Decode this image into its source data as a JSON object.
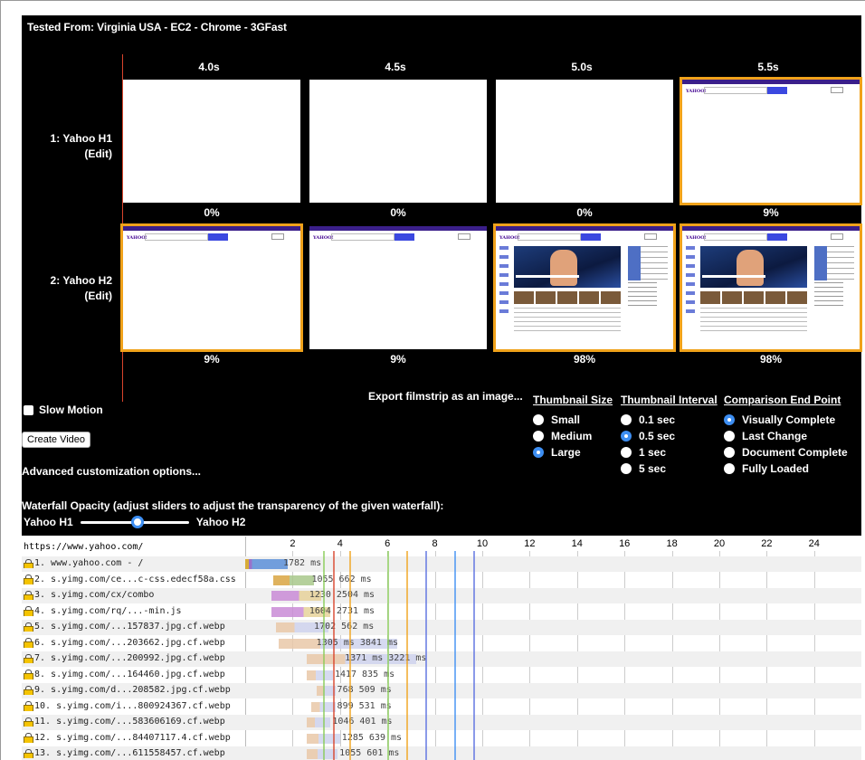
{
  "header": {
    "tested_from_prefix": "Tested From: Virginia USA - EC2 - ",
    "browser": "Chrome",
    "separator": " - ",
    "connection": "3GFast"
  },
  "filmstrip": {
    "times": [
      "4.0s",
      "4.5s",
      "5.0s",
      "5.5s"
    ],
    "rows": [
      {
        "label": "1: Yahoo H1",
        "edit": "(Edit)",
        "frames": [
          {
            "percent": "0%",
            "state": "blank"
          },
          {
            "percent": "0%",
            "state": "blank"
          },
          {
            "percent": "0%",
            "state": "blank"
          },
          {
            "percent": "9%",
            "state": "header",
            "changed": true
          }
        ]
      },
      {
        "label": "2: Yahoo H2",
        "edit": "(Edit)",
        "frames": [
          {
            "percent": "9%",
            "state": "header",
            "changed": true
          },
          {
            "percent": "9%",
            "state": "header"
          },
          {
            "percent": "98%",
            "state": "full",
            "changed": true
          },
          {
            "percent": "98%",
            "state": "full",
            "changed": true
          }
        ]
      }
    ],
    "thumb_logo": "YAHOO!"
  },
  "controls": {
    "export_label": "Export filmstrip as an image...",
    "slow_motion_label": "Slow Motion",
    "create_video_label": "Create Video",
    "advanced_label": "Advanced customization options...",
    "thumbnail_size": {
      "title": "Thumbnail Size",
      "options": [
        {
          "label": "Small",
          "selected": false
        },
        {
          "label": "Medium",
          "selected": false
        },
        {
          "label": "Large",
          "selected": true
        }
      ]
    },
    "thumbnail_interval": {
      "title": "Thumbnail Interval",
      "options": [
        {
          "label": "0.1 sec",
          "selected": false
        },
        {
          "label": "0.5 sec",
          "selected": true
        },
        {
          "label": "1 sec",
          "selected": false
        },
        {
          "label": "5 sec",
          "selected": false
        }
      ]
    },
    "comparison_end": {
      "title": "Comparison End Point",
      "options": [
        {
          "label": "Visually Complete",
          "selected": true
        },
        {
          "label": "Last Change",
          "selected": false
        },
        {
          "label": "Document Complete",
          "selected": false
        },
        {
          "label": "Fully Loaded",
          "selected": false
        }
      ]
    },
    "opacity_label": "Waterfall Opacity (adjust sliders to adjust the transparency of the given waterfall):",
    "slider_left": "Yahoo H1",
    "slider_right": "Yahoo H2",
    "slider_value": 0.5
  },
  "waterfall": {
    "url": "https://www.yahoo.com/",
    "ticks": [
      "2",
      "4",
      "6",
      "8",
      "10",
      "12",
      "14",
      "16",
      "18",
      "20",
      "22",
      "24"
    ],
    "colors": {
      "accent_blue": "#3d8ef2",
      "frame_orange": "#f0a21a",
      "red_line": "#d9442c"
    },
    "rows": [
      {
        "name": "1. www.yahoo.com - /",
        "timing": "1782 ms",
        "start": 0.0,
        "end": 1.78,
        "kind": "html"
      },
      {
        "name": "2. s.yimg.com/ce...c-css.edecf58a.css",
        "timing": "1055 662 ms",
        "start": 1.2,
        "end": 2.9,
        "kind": "css"
      },
      {
        "name": "3. s.yimg.com/cx/combo",
        "timing": "1230 2504 ms",
        "start": 1.1,
        "end": 3.2,
        "kind": "script"
      },
      {
        "name": "4. s.yimg.com/rq/...-min.js",
        "timing": "1604 2731 ms",
        "start": 1.1,
        "end": 3.6,
        "kind": "script"
      },
      {
        "name": "5. s.yimg.com/...157837.jpg.cf.webp",
        "timing": "1702 562 ms",
        "start": 1.3,
        "end": 3.5,
        "kind": "image"
      },
      {
        "name": "6. s.yimg.com/...203662.jpg.cf.webp",
        "timing": "1305 ms 3841 ms",
        "start": 1.4,
        "end": 6.4,
        "kind": "image"
      },
      {
        "name": "7. s.yimg.com/...200992.jpg.cf.webp",
        "timing": "1371 ms 3221 ms",
        "start": 2.6,
        "end": 7.2,
        "kind": "image"
      },
      {
        "name": "8. s.yimg.com/...164460.jpg.cf.webp",
        "timing": "1417 835 ms",
        "start": 2.6,
        "end": 3.7,
        "kind": "image"
      },
      {
        "name": "9. s.yimg.com/d...208582.jpg.cf.webp",
        "timing": "768 509 ms",
        "start": 3.0,
        "end": 3.8,
        "kind": "image"
      },
      {
        "name": "10. s.yimg.com/i...800924367.cf.webp",
        "timing": "899 531 ms",
        "start": 2.8,
        "end": 3.8,
        "kind": "image"
      },
      {
        "name": "11. s.yimg.com/...583606169.cf.webp",
        "timing": "1046 401 ms",
        "start": 2.6,
        "end": 3.6,
        "kind": "image"
      },
      {
        "name": "12. s.yimg.com/...84407117.4.cf.webp",
        "timing": "1285 639 ms",
        "start": 2.6,
        "end": 4.0,
        "kind": "image"
      },
      {
        "name": "13. s.yimg.com/...611558457.cf.webp",
        "timing": "1055 601 ms",
        "start": 2.6,
        "end": 3.9,
        "kind": "image"
      }
    ]
  }
}
